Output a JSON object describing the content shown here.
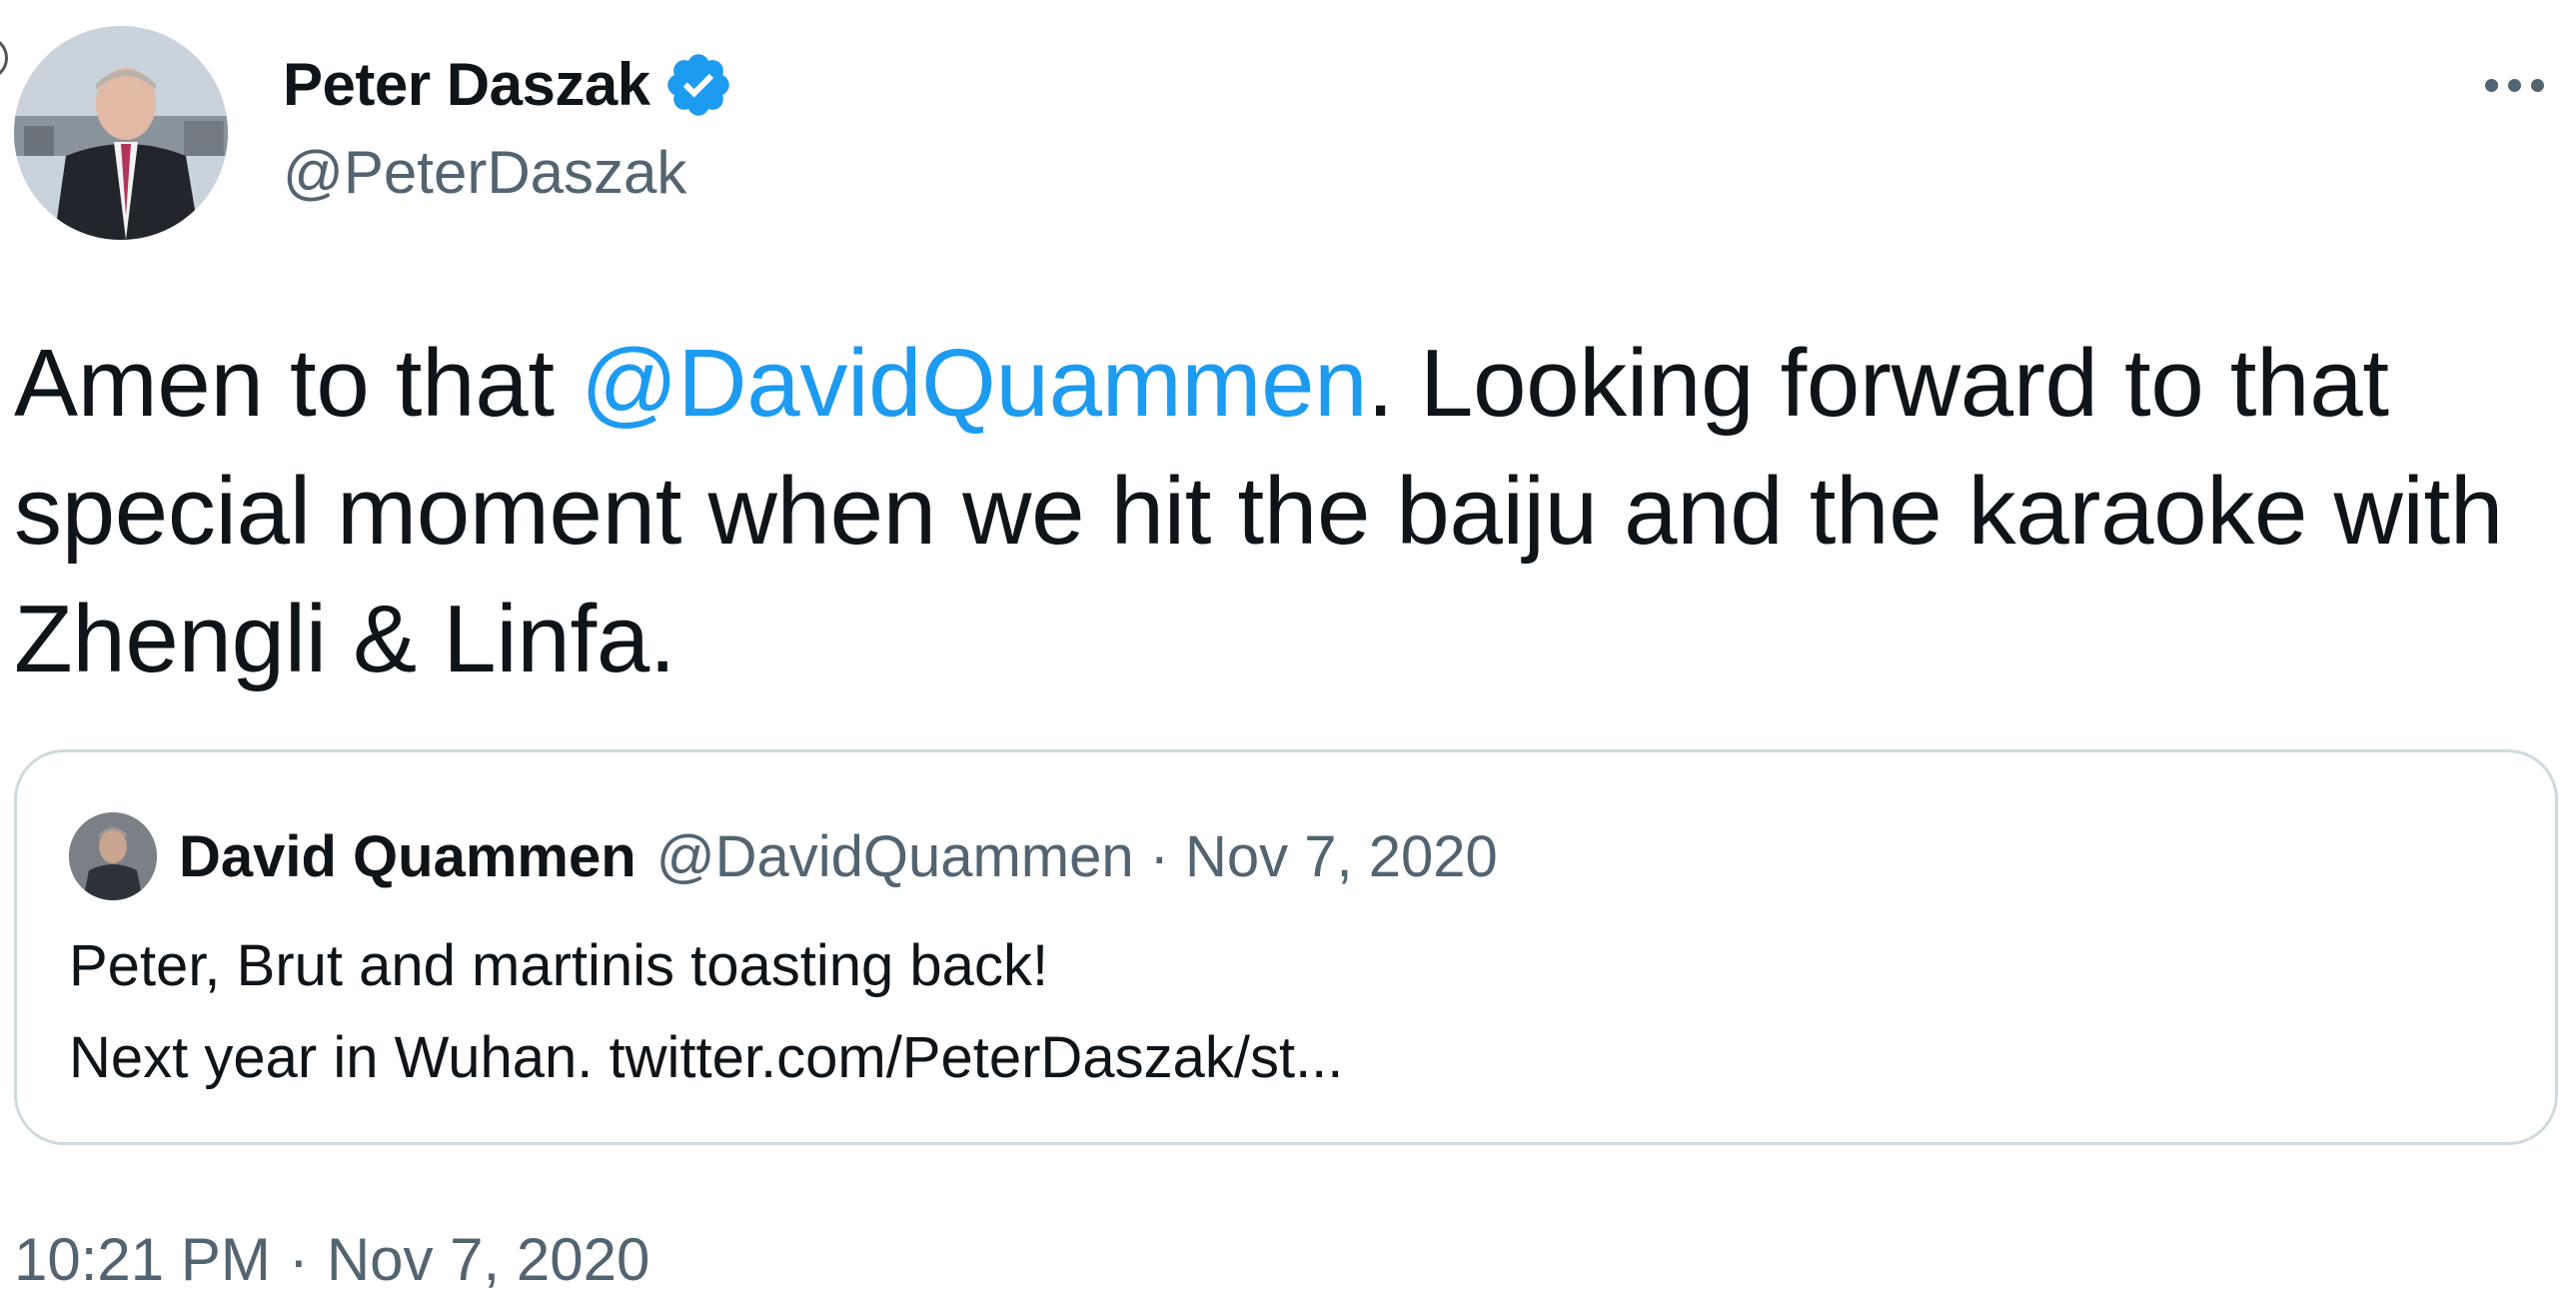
{
  "author": {
    "name": "Peter Daszak",
    "handle": "@PeterDaszak",
    "verified": true,
    "avatar_icon": "profile-photo"
  },
  "tweet": {
    "text_before_mention": "Amen to that ",
    "mention": "@DavidQuammen",
    "text_after_mention": ". Looking forward to that special moment when we hit the baiju and the karaoke with Zhengli & Linfa."
  },
  "quoted_tweet": {
    "name": "David Quammen",
    "handle": "@DavidQuammen",
    "separator": "·",
    "date": "Nov 7, 2020",
    "line1": "Peter, Brut and martinis toasting back!",
    "line2": "Next year in Wuhan. twitter.com/PeterDaszak/st..."
  },
  "meta": {
    "time": "10:21 PM",
    "separator": "·",
    "date": "Nov 7, 2020"
  },
  "colors": {
    "accent": "#1d9bf0",
    "secondary_text": "#536471",
    "primary_text": "#0f1419",
    "border": "#cfd9de"
  },
  "icons": {
    "verified": "verified-badge-icon",
    "more": "more-options-icon"
  }
}
